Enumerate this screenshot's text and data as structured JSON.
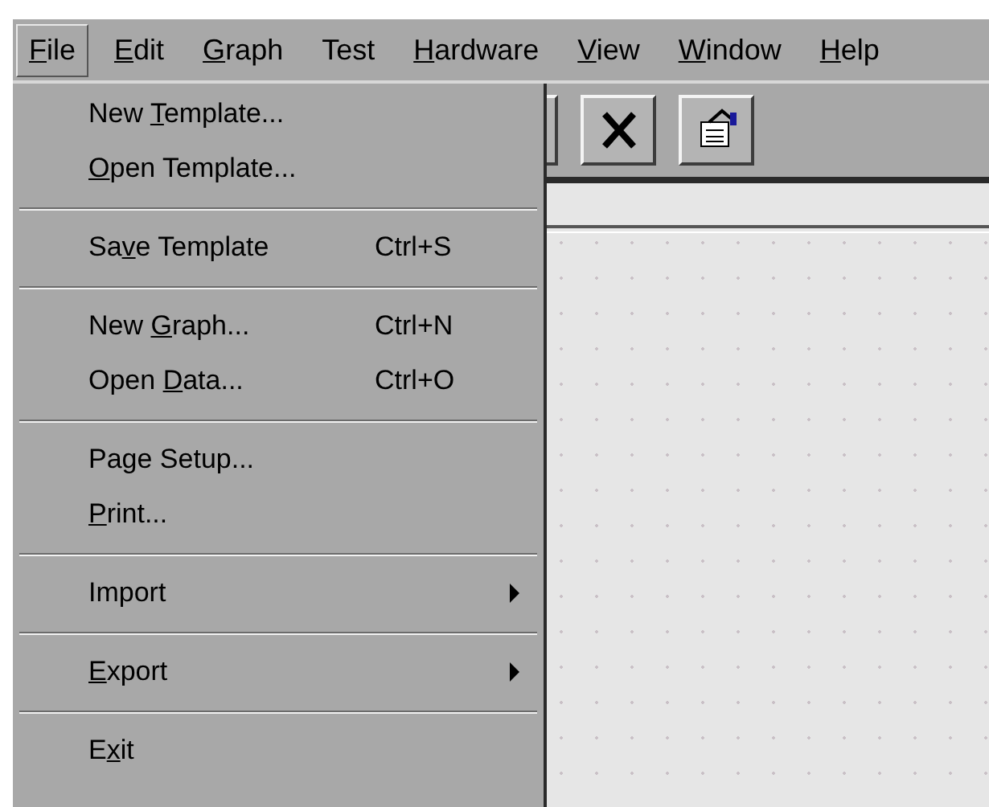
{
  "menubar": [
    {
      "key": "F",
      "post": "ile",
      "selected": true
    },
    {
      "key": "E",
      "post": "dit",
      "selected": false
    },
    {
      "key": "G",
      "post": "raph",
      "selected": false
    },
    {
      "pre": "Test",
      "selected": false
    },
    {
      "key": "H",
      "post": "ardware",
      "selected": false
    },
    {
      "key": "V",
      "post": "iew",
      "selected": false
    },
    {
      "key": "W",
      "post": "indow",
      "selected": false
    },
    {
      "key": "H",
      "post": "elp",
      "selected": false
    }
  ],
  "file_menu": [
    {
      "kind": "item",
      "pre": "New ",
      "key": "T",
      "post": "emplate..."
    },
    {
      "kind": "item",
      "key": "O",
      "post": "pen Template..."
    },
    {
      "kind": "separator"
    },
    {
      "kind": "item",
      "pre": "Sa",
      "key": "v",
      "post": "e Template",
      "shortcut": "Ctrl+S"
    },
    {
      "kind": "separator"
    },
    {
      "kind": "item",
      "pre": "New ",
      "key": "G",
      "post": "raph...",
      "shortcut": "Ctrl+N"
    },
    {
      "kind": "item",
      "pre": "Open ",
      "key": "D",
      "post": "ata...",
      "shortcut": "Ctrl+O"
    },
    {
      "kind": "separator"
    },
    {
      "kind": "item",
      "pre": "Page Setup..."
    },
    {
      "kind": "item",
      "key": "P",
      "post": "rint..."
    },
    {
      "kind": "separator"
    },
    {
      "kind": "submenu",
      "pre": "Import"
    },
    {
      "kind": "separator"
    },
    {
      "kind": "submenu",
      "key": "E",
      "post": "xport"
    },
    {
      "kind": "separator"
    },
    {
      "kind": "item",
      "pre": "E",
      "key": "x",
      "post": "it"
    }
  ]
}
